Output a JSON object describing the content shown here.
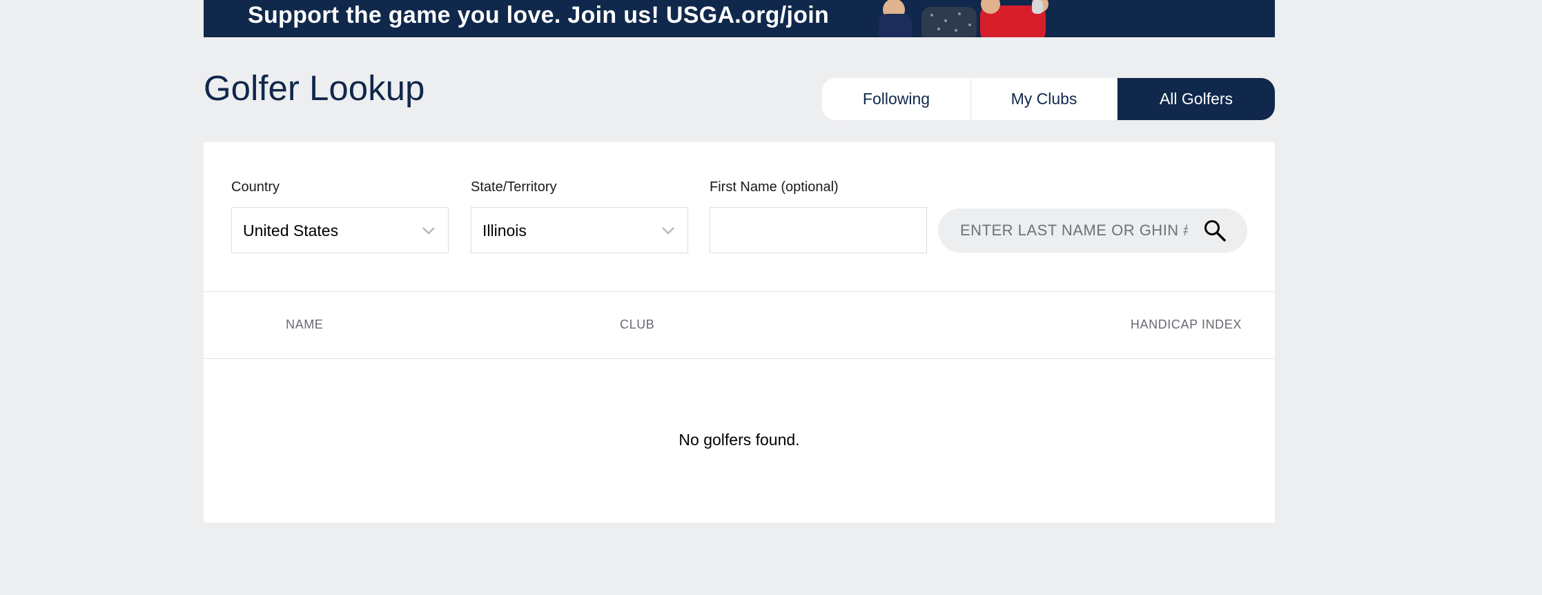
{
  "banner": {
    "text": "Support the game you love.  Join us!  USGA.org/join"
  },
  "page": {
    "title": "Golfer Lookup"
  },
  "tabs": [
    {
      "label": "Following",
      "active": false
    },
    {
      "label": "My Clubs",
      "active": false
    },
    {
      "label": "All Golfers",
      "active": true
    }
  ],
  "filters": {
    "country": {
      "label": "Country",
      "value": "United States"
    },
    "state": {
      "label": "State/Territory",
      "value": "Illinois"
    },
    "first_name": {
      "label": "First Name (optional)",
      "value": ""
    },
    "search": {
      "placeholder": "ENTER LAST NAME OR GHIN #",
      "value": ""
    }
  },
  "table": {
    "columns": [
      "NAME",
      "CLUB",
      "HANDICAP INDEX"
    ],
    "empty_message": "No golfers found."
  },
  "icons": {
    "search": "search-icon",
    "chevron": "chevron-down-icon"
  },
  "colors": {
    "brand_navy": "#10284b",
    "background": "#edeef0"
  }
}
